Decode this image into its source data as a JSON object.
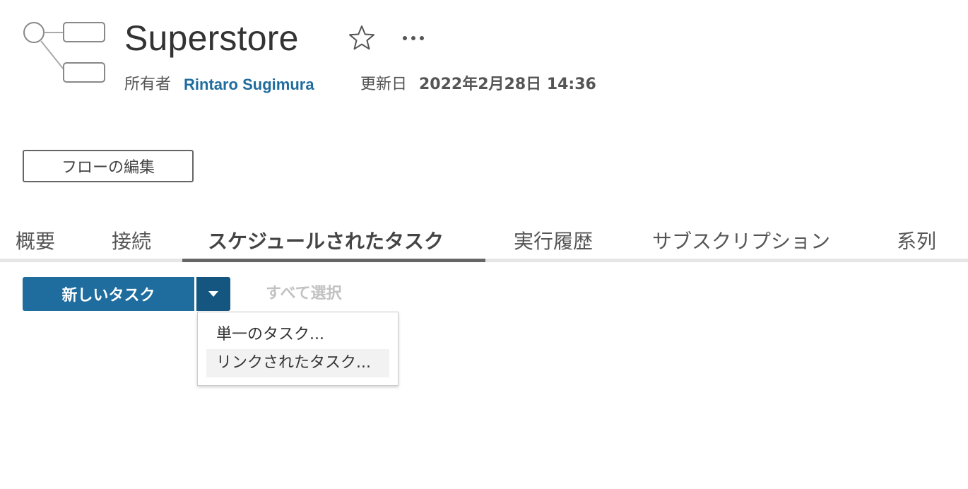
{
  "header": {
    "title": "Superstore",
    "owner_label": "所有者",
    "owner_name": "Rintaro Sugimura",
    "updated_label": "更新日",
    "updated_value": "2022年2月28日 14:36",
    "icons": [
      "flow-icon",
      "star-icon",
      "more-icon"
    ]
  },
  "actions": {
    "edit_flow_label": "フローの編集"
  },
  "tabs": [
    {
      "label": "概要",
      "active": false
    },
    {
      "label": "接続",
      "active": false
    },
    {
      "label": "スケジュールされたタスク",
      "active": true
    },
    {
      "label": "実行履歴",
      "active": false
    },
    {
      "label": "サブスクリプション",
      "active": false
    },
    {
      "label": "系列",
      "active": false
    }
  ],
  "toolbar": {
    "new_task_label": "新しいタスク",
    "select_all_label": "すべて選択"
  },
  "dropdown": {
    "items": [
      {
        "label": "単一のタスク..."
      },
      {
        "label": "リンクされたタスク..."
      }
    ]
  },
  "colors": {
    "accent": "#1f6c9e",
    "accent_dark": "#155680",
    "text": "#333333",
    "disabled_text": "#c2c2c2"
  }
}
